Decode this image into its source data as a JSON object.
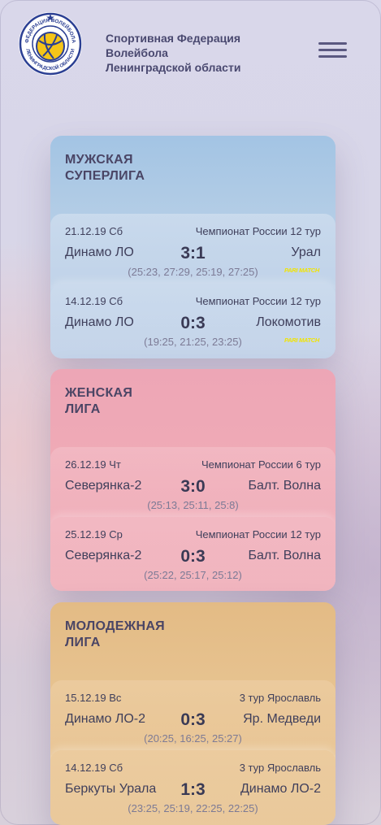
{
  "header": {
    "federation_name": "Спортивная Федерация\nВолейбола\nЛенинградской области",
    "logo_text_top": "ФЕДЕРАЦИЯ ВОЛЕЙБОЛА",
    "logo_text_bottom": "ЛЕНИНГРАДСКОЙ ОБЛАСТИ",
    "menu_icon": "hamburger-menu-icon"
  },
  "leagues": [
    {
      "title": "МУЖСКАЯ\nСУПЕРЛИГА",
      "matches": [
        {
          "date": "21.12.19 Сб",
          "tour": "Чемпионат России 12 тур",
          "home": "Динамо ЛО",
          "score": "3:1",
          "away": "Урал",
          "sets": "(25:23, 27:29, 25:19, 27:25)",
          "sponsor": "PARI MATCH"
        },
        {
          "date": "14.12.19 Сб",
          "tour": "Чемпионат России 12 тур",
          "home": "Динамо ЛО",
          "score": "0:3",
          "away": "Локомотив",
          "sets": "(19:25, 21:25, 23:25)",
          "sponsor": "PARI MATCH"
        }
      ]
    },
    {
      "title": "ЖЕНСКАЯ\nЛИГА",
      "matches": [
        {
          "date": "26.12.19 Чт",
          "tour": "Чемпионат России 6 тур",
          "home": "Северянка-2",
          "score": "3:0",
          "away": "Балт. Волна",
          "sets": "(25:13, 25:11, 25:8)"
        },
        {
          "date": "25.12.19 Ср",
          "tour": "Чемпионат России 12 тур",
          "home": "Северянка-2",
          "score": "0:3",
          "away": "Балт. Волна",
          "sets": "(25:22, 25:17, 25:12)"
        }
      ]
    },
    {
      "title": "МОЛОДЕЖНАЯ\nЛИГА",
      "matches": [
        {
          "date": "15.12.19 Вс",
          "tour": "3 тур Ярославль",
          "home": "Динамо ЛО-2",
          "score": "0:3",
          "away": "Яр. Медведи",
          "sets": "(20:25, 16:25, 25:27)"
        },
        {
          "date": "14.12.19 Сб",
          "tour": "3 тур Ярославль",
          "home": "Беркуты Урала",
          "score": "1:3",
          "away": "Динамо ЛО-2",
          "sets": "(23:25, 25:19, 22:25, 22:25)"
        }
      ]
    }
  ],
  "colors": {
    "men_card": "#a3c4e4",
    "women_card": "#eda6b6",
    "youth_card": "#e3bb85",
    "sponsor_yellow": "#f2e400",
    "logo_blue": "#2b3f93",
    "logo_yellow": "#f5c518"
  }
}
